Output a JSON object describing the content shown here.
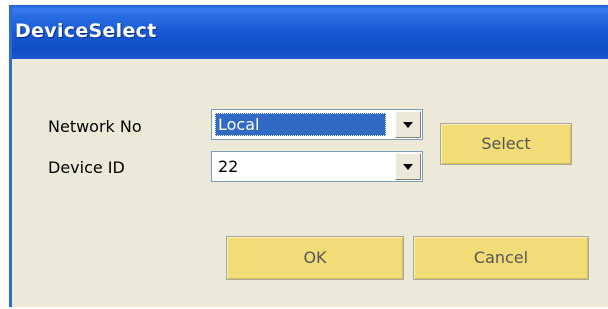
{
  "window": {
    "title": "DeviceSelect"
  },
  "form": {
    "network_label": "Network No",
    "network_value": "Local",
    "device_label": "Device ID",
    "device_value": "22"
  },
  "buttons": {
    "select_label": "Select",
    "ok_label": "OK",
    "cancel_label": "Cancel"
  },
  "colors": {
    "titlebar": "#1657d1",
    "dialog_background": "#ece9d8",
    "button_face": "#f2dc78",
    "selection": "#316ac5"
  },
  "icons": {
    "dropdown_arrow": "chevron-down-icon"
  }
}
